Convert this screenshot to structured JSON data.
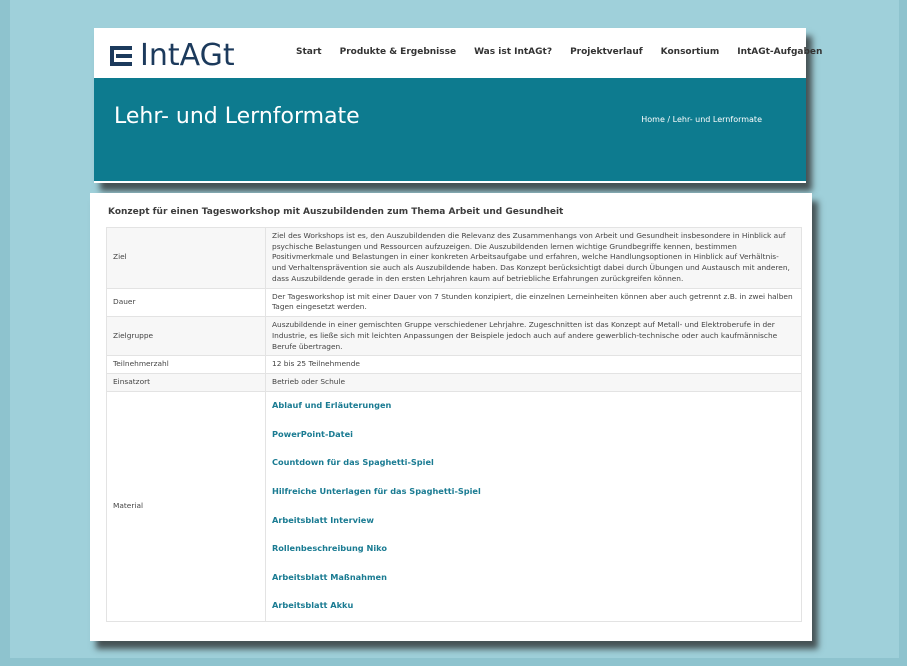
{
  "header": {
    "logo_text": "IntAGt",
    "logo_icon": "stacked-bars-logo",
    "nav": [
      "Start",
      "Produkte & Ergebnisse",
      "Was ist IntAGt?",
      "Projektverlauf",
      "Konsortium",
      "IntAGt-Aufgaben"
    ]
  },
  "banner": {
    "title": "Lehr- und Lernformate",
    "breadcrumb": "Home  /  Lehr- und Lernformate"
  },
  "content": {
    "title": "Konzept für einen Tagesworkshop mit Auszubildenden zum Thema Arbeit und Gesundheit",
    "rows": [
      {
        "label": "Ziel",
        "value": "Ziel des Workshops ist es, den Auszubildenden die Relevanz des Zusammenhangs von Arbeit und Gesundheit insbesondere in Hinblick auf psychische Belastungen und Ressourcen aufzuzeigen. Die Auszubildenden lernen wichtige Grundbegriffe kennen, bestimmen Positivmerkmale und Belastungen in einer konkreten Arbeitsaufgabe und erfahren, welche Handlungsoptionen in Hinblick auf Verhältnis- und Verhaltensprävention sie auch als Auszubildende haben. Das Konzept berücksichtigt dabei durch Übungen und Austausch mit anderen, dass Auszubildende gerade in den ersten Lehrjahren kaum auf betriebliche Erfahrungen zurückgreifen können."
      },
      {
        "label": "Dauer",
        "value": "Der Tagesworkshop ist mit einer Dauer von 7 Stunden konzipiert, die einzelnen Lerneinheiten können aber auch getrennt z.B. in zwei halben Tagen eingesetzt werden."
      },
      {
        "label": "Zielgruppe",
        "value": "Auszubildende in einer gemischten Gruppe verschiedener Lehrjahre. Zugeschnitten ist das Konzept auf Metall- und Elektroberufe in der Industrie, es ließe sich mit leichten Anpassungen der Beispiele jedoch auch auf andere gewerblich-technische oder auch kaufmännische Berufe übertragen."
      },
      {
        "label": "Teilnehmerzahl",
        "value": "12 bis 25 Teilnehmende"
      },
      {
        "label": "Einsatzort",
        "value": "Betrieb oder Schule"
      }
    ],
    "material_label": "Material",
    "materials": [
      "Ablauf und Erläuterungen",
      "PowerPoint-Datei",
      "Countdown für das Spaghetti-Spiel",
      "Hilfreiche Unterlagen für das Spaghetti-Spiel",
      "Arbeitsblatt Interview",
      "Rollenbeschreibung Niko",
      "Arbeitsblatt Maßnahmen",
      "Arbeitsblatt Akku"
    ]
  },
  "colors": {
    "background": "#9fd0da",
    "banner": "#0d7b8f",
    "link": "#1a7b92",
    "logo": "#1c3a5c"
  }
}
